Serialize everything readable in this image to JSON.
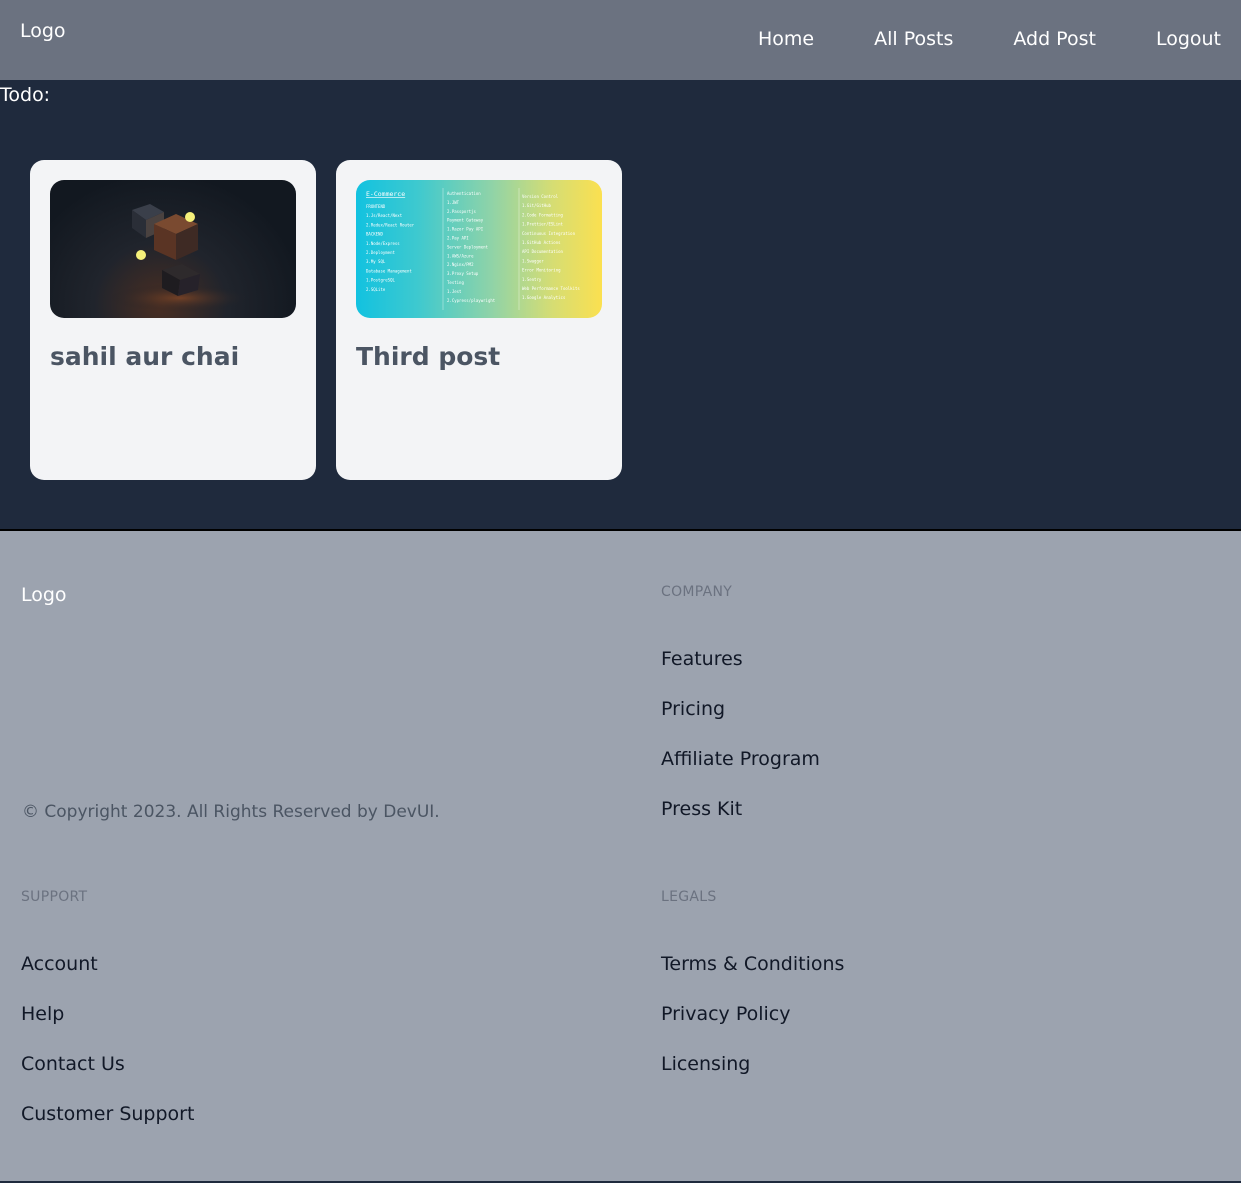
{
  "header": {
    "logo": "Logo",
    "nav": [
      {
        "label": "Home"
      },
      {
        "label": "All Posts"
      },
      {
        "label": "Add Post"
      },
      {
        "label": "Logout"
      }
    ]
  },
  "main": {
    "todo_label": "Todo:",
    "posts": [
      {
        "title": "sahil aur chai",
        "image": "3d-cubes-image"
      },
      {
        "title": "Third post",
        "image": "ecommerce-roadmap-image"
      }
    ],
    "roadmap_image_text": {
      "heading": "E-Commerce",
      "col1": [
        "FRONTEND",
        "1.Js/React/Next",
        "2.Redux/React Router",
        "BACKEND",
        "1.Node/Express",
        "2.Deployment",
        "3.My SQL",
        "Database Management",
        "1.PostgreSQL",
        "2.SQLite"
      ],
      "col2": [
        "Authentication",
        "1.JWT",
        "2.Passportjs",
        "Payment Gateway",
        "1.Razor Pay API",
        "2.Pay API",
        "Server Deployment",
        "1.AWS/Azure",
        "2.Nginx/PM2",
        "3.Proxy Setup",
        "Testing",
        "1.Jest",
        "2.Cypress/playwright"
      ],
      "col3": [
        "Version Control",
        "1.Git/GitHub",
        "2.Code Formatting",
        "1.Prettier/ESLint",
        "Continuous Integration",
        "1.GitHub Actions",
        "API Documentation",
        "1.Swagger",
        "Error Monitoring",
        "1.Sentry",
        "Web Performance Toolkits",
        "1.Google Analytics"
      ]
    }
  },
  "footer": {
    "logo": "Logo",
    "copyright": "© Copyright 2023. All Rights Reserved by DevUI.",
    "company": {
      "heading": "COMPANY",
      "links": [
        "Features",
        "Pricing",
        "Affiliate Program",
        "Press Kit"
      ]
    },
    "support": {
      "heading": "SUPPORT",
      "links": [
        "Account",
        "Help",
        "Contact Us",
        "Customer Support"
      ]
    },
    "legals": {
      "heading": "LEGALS",
      "links": [
        "Terms & Conditions",
        "Privacy Policy",
        "Licensing"
      ]
    }
  },
  "colors": {
    "header_bg": "#6b7280",
    "main_bg": "#1f2a3d",
    "card_bg": "#f3f4f6",
    "footer_bg": "#9ca3af"
  }
}
